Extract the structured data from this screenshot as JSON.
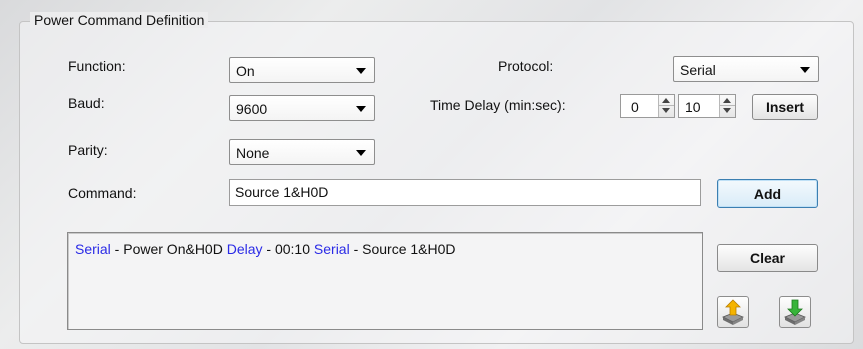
{
  "group": {
    "title": "Power Command Definition"
  },
  "labels": {
    "function": "Function:",
    "baud": "Baud:",
    "parity": "Parity:",
    "command": "Command:",
    "protocol": "Protocol:",
    "time_delay": "Time Delay (min:sec):"
  },
  "selects": {
    "function": "On",
    "baud": "9600",
    "parity": "None",
    "protocol": "Serial"
  },
  "time_delay": {
    "minutes": "0",
    "seconds": "10"
  },
  "command_input": {
    "value": "Source 1&H0D"
  },
  "buttons": {
    "insert": "Insert",
    "add": "Add",
    "clear": "Clear"
  },
  "sequence": [
    {
      "protocol": "Serial",
      "text": " - Power On&H0D "
    },
    {
      "protocol": "Delay",
      "text": " - 00:10 "
    },
    {
      "protocol": "Serial",
      "text": " - Source 1&H0D"
    }
  ],
  "icons": {
    "upload": "upload-disk-icon",
    "download": "download-disk-icon"
  },
  "colors": {
    "protocol_text": "#2a2ae6",
    "focus_border": "#3c7fb1"
  }
}
